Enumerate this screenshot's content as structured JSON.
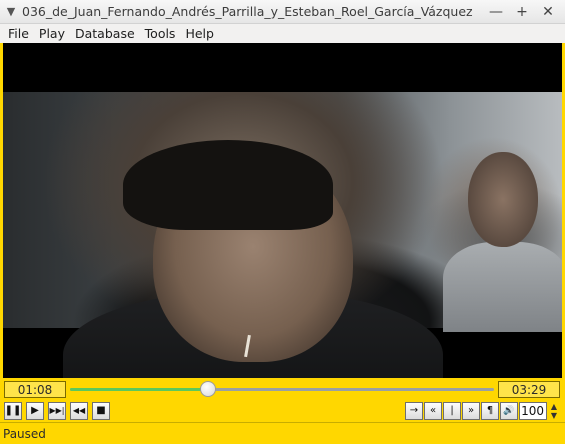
{
  "window": {
    "title": "036_de_Juan_Fernando_Andrés_Parrilla_y_Esteban_Roel_García_Vázquez",
    "menu_glyph": "▼",
    "minimize_glyph": "—",
    "maximize_glyph": "+",
    "close_glyph": "✕"
  },
  "menubar": {
    "items": [
      {
        "label": "File"
      },
      {
        "label": "Play"
      },
      {
        "label": "Database"
      },
      {
        "label": "Tools"
      },
      {
        "label": "Help"
      }
    ]
  },
  "seek": {
    "elapsed": "01:08",
    "total": "03:29",
    "progress": 0.325
  },
  "controls": {
    "pause": {
      "glyph": "❚❚",
      "icon": "pause-icon"
    },
    "play": {
      "glyph": "▶",
      "icon": "play-icon"
    },
    "next": {
      "glyph": "▶▶|",
      "icon": "skip-next-icon"
    },
    "rewind": {
      "glyph": "◀◀",
      "icon": "rewind-icon"
    },
    "stop": {
      "glyph": "■",
      "icon": "stop-icon"
    },
    "right_buttons": [
      {
        "glyph": "→",
        "icon": "arrow-right-icon"
      },
      {
        "glyph": "«",
        "icon": "double-left-icon"
      },
      {
        "glyph": "|",
        "icon": "bar-icon"
      },
      {
        "glyph": "»",
        "icon": "double-right-icon"
      },
      {
        "glyph": "¶",
        "icon": "pilcrow-icon"
      },
      {
        "glyph": "🔊",
        "icon": "volume-icon"
      }
    ],
    "volume": "100",
    "spin_up": "▲",
    "spin_down": "▼"
  },
  "status": {
    "text": "Paused"
  },
  "colors": {
    "accent": "#ffd700",
    "progress": "#5cc85c"
  }
}
